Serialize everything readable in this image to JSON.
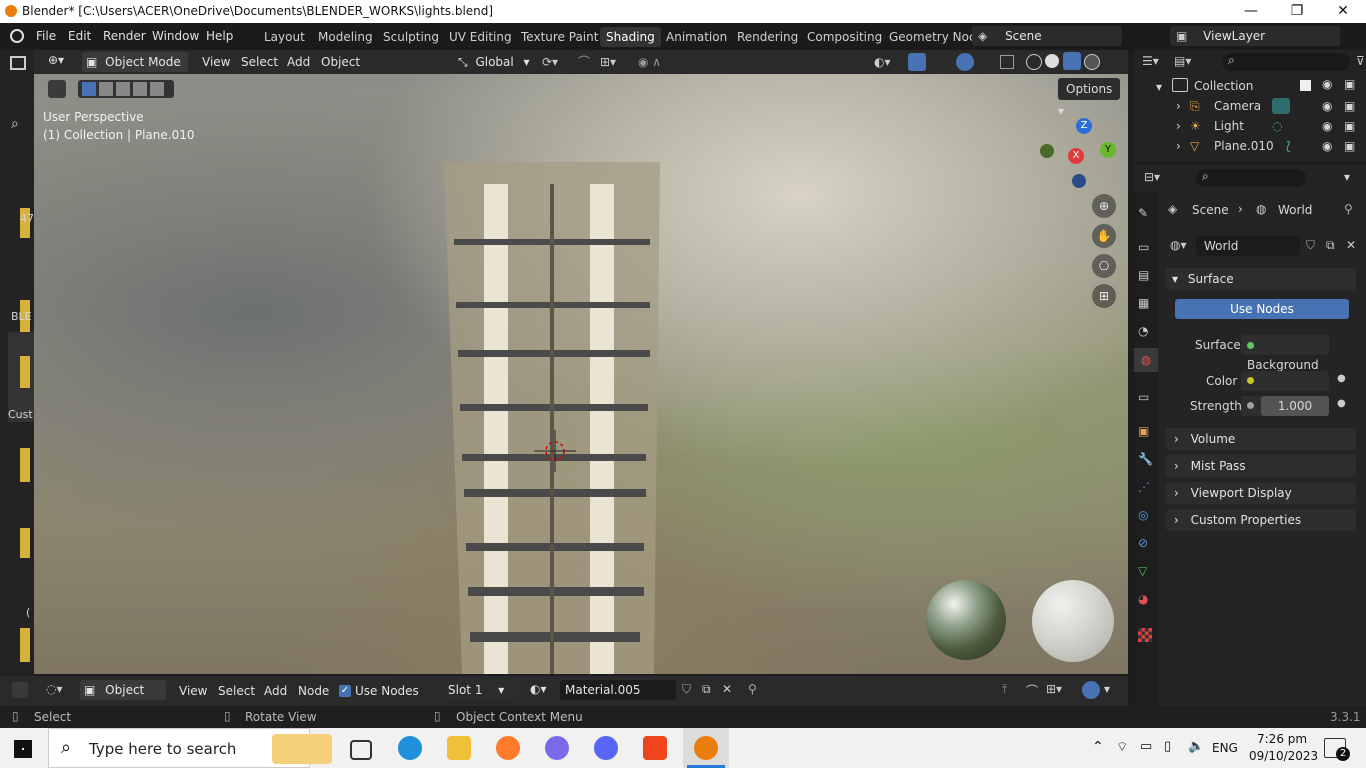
{
  "titlebar": {
    "title": "Blender* [C:\\Users\\ACER\\OneDrive\\Documents\\BLENDER_WORKS\\lights.blend]",
    "minimize": "—",
    "maximize": "❐",
    "close": "✕"
  },
  "menu": {
    "items": [
      "File",
      "Edit",
      "Render",
      "Window",
      "Help"
    ],
    "workspaces": [
      "Layout",
      "Modeling",
      "Sculpting",
      "UV Editing",
      "Texture Paint",
      "Shading",
      "Animation",
      "Rendering",
      "Compositing",
      "Geometry Noc"
    ],
    "active_workspace": "Shading",
    "scene": "Scene",
    "view_layer": "ViewLayer"
  },
  "viewport_header": {
    "mode": "Object Mode",
    "menus": [
      "View",
      "Select",
      "Add",
      "Object"
    ],
    "orientation": "Global",
    "options_label": "Options"
  },
  "viewport": {
    "perspective": "User Perspective",
    "collection": "(1) Collection | Plane.010",
    "gizmo_axes": [
      "Z",
      "X",
      "Y"
    ]
  },
  "left_strip": {
    "labels": [
      "47",
      "BLE",
      "Cust",
      "("
    ]
  },
  "outliner": {
    "root": "Collection",
    "items": [
      {
        "name": "Camera",
        "icon": "camera-icon"
      },
      {
        "name": "Light",
        "icon": "light-icon"
      },
      {
        "name": "Plane.010",
        "icon": "mesh-icon"
      }
    ]
  },
  "properties": {
    "breadcrumb_scene": "Scene",
    "breadcrumb_world": "World",
    "world_name": "World",
    "surface_panel": "Surface",
    "use_nodes": "Use Nodes",
    "surface_label": "Surface",
    "surface_value": "Background",
    "color_label": "Color",
    "strength_label": "Strength",
    "strength_value": "1.000",
    "collapsed_panels": [
      "Volume",
      "Mist Pass",
      "Viewport Display",
      "Custom Properties"
    ],
    "colors": {
      "use_nodes_bg": "#4772b3",
      "color_socket": "#c7c729",
      "surface_socket": "#63c763"
    }
  },
  "node_header": {
    "type": "Object",
    "menus": [
      "View",
      "Select",
      "Add",
      "Node"
    ],
    "use_nodes": "Use Nodes",
    "slot": "Slot 1",
    "material": "Material.005"
  },
  "statusbar": {
    "select": "Select",
    "rotate": "Rotate View",
    "context": "Object Context Menu",
    "version": "3.3.1"
  },
  "taskbar": {
    "search_placeholder": "Type here to search",
    "language": "ENG",
    "time": "7:26 pm",
    "date": "09/10/2023",
    "notifications": "2"
  }
}
